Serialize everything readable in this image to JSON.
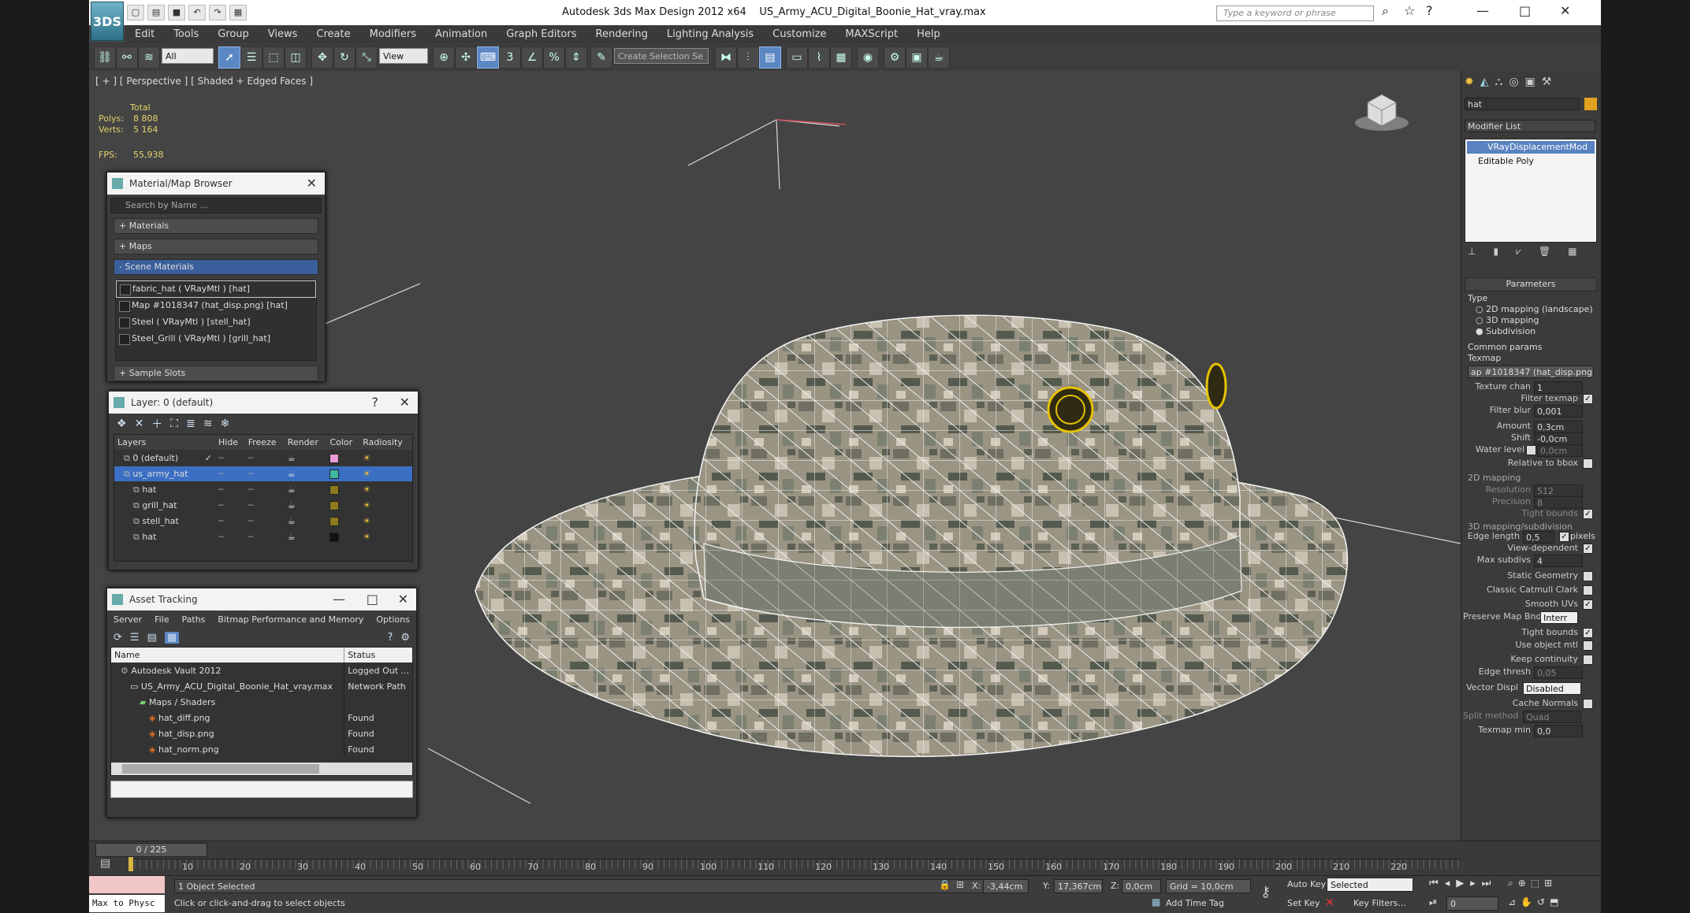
{
  "window": {
    "title": "Autodesk 3ds Max Design 2012 x64",
    "filename": "US_Army_ACU_Digital_Boonie_Hat_vray.max",
    "search_placeholder": "Type a keyword or phrase",
    "logo_text": "3DS"
  },
  "menu": [
    "Edit",
    "Tools",
    "Group",
    "Views",
    "Create",
    "Modifiers",
    "Animation",
    "Graph Editors",
    "Rendering",
    "Lighting Analysis",
    "Customize",
    "MAXScript",
    "Help"
  ],
  "toolbar": {
    "filter_select": "All",
    "view_select": "View",
    "selection_set": "Create Selection Se"
  },
  "viewport": {
    "label": "[ + ] [ Perspective ] [ Shaded + Edged Faces ]",
    "stats": {
      "total": "Total",
      "polys_label": "Polys:",
      "polys": "8 808",
      "verts_label": "Verts:",
      "verts": "5 164",
      "fps_label": "FPS:",
      "fps": "55,938"
    }
  },
  "material_browser": {
    "title": "Material/Map Browser",
    "search_placeholder": "Search by Name ...",
    "rollouts": [
      "+ Materials",
      "+ Maps",
      "- Scene Materials",
      "+ Sample Slots"
    ],
    "scene_materials": [
      "fabric_hat  ( VRayMtl )  [hat]",
      "Map #1018347 (hat_disp.png)  [hat]",
      "Steel  ( VRayMtl )  [stell_hat]",
      "Steel_Grill  ( VRayMtl )  [grill_hat]"
    ]
  },
  "layer_panel": {
    "title": "Layer: 0 (default)",
    "help": "?",
    "columns": [
      "Layers",
      "Hide",
      "Freeze",
      "Render",
      "Color",
      "Radiosity"
    ],
    "rows": [
      {
        "name": "0 (default)",
        "color": "#e79bd6",
        "indent": 1,
        "selected": false,
        "current": true
      },
      {
        "name": "us_army_hat",
        "color": "#3fb8a0",
        "indent": 1,
        "selected": true,
        "current": false
      },
      {
        "name": "hat",
        "color": "#8c7a1e",
        "indent": 2,
        "selected": false,
        "current": false
      },
      {
        "name": "grill_hat",
        "color": "#8c7a1e",
        "indent": 2,
        "selected": false,
        "current": false
      },
      {
        "name": "stell_hat",
        "color": "#8c7a1e",
        "indent": 2,
        "selected": false,
        "current": false
      },
      {
        "name": "hat",
        "color": "#111111",
        "indent": 2,
        "selected": false,
        "current": false
      }
    ]
  },
  "asset_tracking": {
    "title": "Asset Tracking",
    "menu": [
      "Server",
      "File",
      "Paths",
      "Bitmap Performance and Memory",
      "Options"
    ],
    "columns": [
      "Name",
      "Status"
    ],
    "rows": [
      {
        "name": "Autodesk Vault 2012",
        "status": "Logged Out ...",
        "indent": 1
      },
      {
        "name": "US_Army_ACU_Digital_Boonie_Hat_vray.max",
        "status": "Network Path",
        "indent": 2
      },
      {
        "name": "Maps / Shaders",
        "status": "",
        "indent": 3
      },
      {
        "name": "hat_diff.png",
        "status": "Found",
        "indent": 4
      },
      {
        "name": "hat_disp.png",
        "status": "Found",
        "indent": 4
      },
      {
        "name": "hat_norm.png",
        "status": "Found",
        "indent": 4
      }
    ]
  },
  "command_panel": {
    "object_name": "hat",
    "modifier_list": "Modifier List",
    "stack": [
      "VRayDisplacementMod",
      "Editable Poly"
    ],
    "parameters_title": "Parameters",
    "type_label": "Type",
    "type_options": [
      "2D mapping (landscape)",
      "3D mapping",
      "Subdivision"
    ],
    "common_params": "Common params",
    "texmap_label": "Texmap",
    "texmap_value": "ap #1018347 (hat_disp.png)",
    "texture_chan_label": "Texture chan",
    "texture_chan": "1",
    "filter_texmap": "Filter texmap",
    "filter_blur_label": "Filter blur",
    "filter_blur": "0,001",
    "amount_label": "Amount",
    "amount": "0,3cm",
    "shift_label": "Shift",
    "shift": "-0,0cm",
    "water_level_label": "Water level",
    "water_level": "0,0cm",
    "relative_bbox": "Relative to bbox",
    "mapping_2d": "2D mapping",
    "resolution_label": "Resolution",
    "resolution": "512",
    "precision_label": "Precision",
    "precision": "8",
    "tight_bounds": "Tight bounds",
    "mapping_3d": "3D mapping/subdivision",
    "edge_length_label": "Edge length",
    "edge_length": "0,5",
    "pixels": "pixels",
    "view_dependent": "View-dependent",
    "max_subdivs_label": "Max subdivs",
    "max_subdivs": "4",
    "static_geometry": "Static Geometry",
    "classic_catmull": "Classic Catmull Clark",
    "smooth_uvs": "Smooth UVs",
    "preserve_map_label": "Preserve Map Bnd",
    "preserve_map": "Interr",
    "tight_bounds2": "Tight bounds",
    "use_object_mtl": "Use object mtl",
    "keep_continuity": "Keep continuity",
    "edge_thresh_label": "Edge thresh",
    "edge_thresh": "0,05",
    "vector_displ_label": "Vector Displ",
    "vector_displ": "Disabled",
    "cache_normals": "Cache Normals",
    "split_method_label": "Split method",
    "split_method": "Quad",
    "texmap_min_label": "Texmap min",
    "texmap_min": "0,0"
  },
  "timeline": {
    "frame": "0 / 225",
    "ticks": [
      "10",
      "20",
      "30",
      "40",
      "50",
      "60",
      "70",
      "80",
      "90",
      "100",
      "110",
      "120",
      "130",
      "140",
      "150",
      "160",
      "170",
      "180",
      "190",
      "200",
      "210",
      "220"
    ]
  },
  "status": {
    "maxscript": "Max to Physc",
    "selected": "1 Object Selected",
    "prompt": "Click or click-and-drag to select objects",
    "x_label": "X:",
    "x": "-3,44cm",
    "y_label": "Y:",
    "y": "17,367cm",
    "z_label": "Z:",
    "z": "0,0cm",
    "grid": "Grid = 10,0cm",
    "add_time_tag": "Add Time Tag",
    "auto_key": "Auto Key",
    "set_key": "Set Key",
    "key_filters": "Key Filters...",
    "selected_dropdown": "Selected",
    "frame_field": "0"
  }
}
